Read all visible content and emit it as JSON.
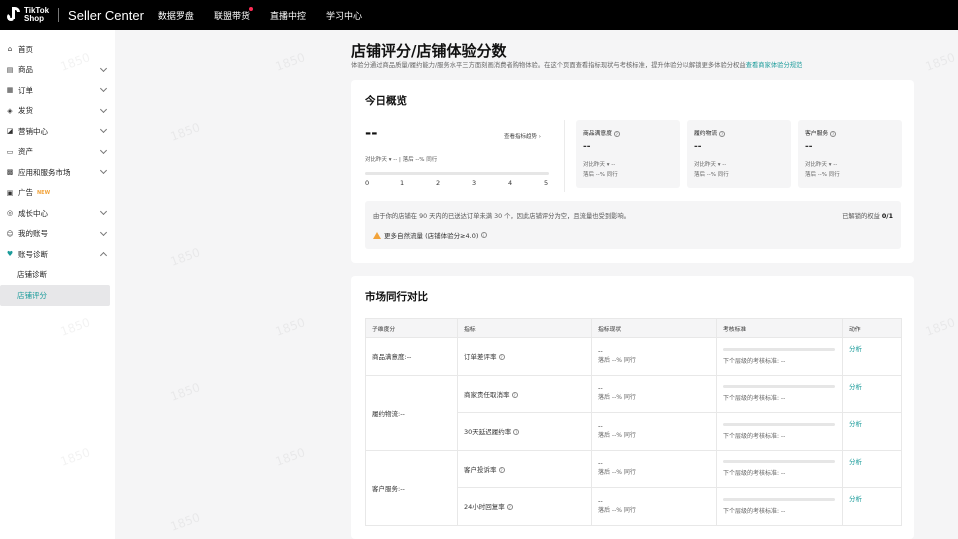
{
  "topbar": {
    "brand_line1": "TikTok",
    "brand_line2": "Shop",
    "title": "Seller Center",
    "nav": [
      "数据罗盘",
      "联盟带货",
      "直播中控",
      "学习中心"
    ]
  },
  "sidebar": {
    "items": [
      {
        "icon": "⌂",
        "label": "首页"
      },
      {
        "icon": "▤",
        "label": "商品"
      },
      {
        "icon": "▦",
        "label": "订单"
      },
      {
        "icon": "◈",
        "label": "发货"
      },
      {
        "icon": "◪",
        "label": "营销中心"
      },
      {
        "icon": "▭",
        "label": "资产"
      },
      {
        "icon": "▩",
        "label": "应用和服务市场"
      },
      {
        "icon": "▣",
        "label": "广告",
        "badge": "NEW"
      },
      {
        "icon": "◎",
        "label": "成长中心"
      },
      {
        "icon": "☺",
        "label": "我的账号"
      },
      {
        "icon": "♥",
        "label": "账号诊断"
      }
    ],
    "sub_items": [
      "店铺诊断",
      "店铺评分"
    ]
  },
  "watermark": "1850",
  "page": {
    "title": "店铺评分/店铺体验分数",
    "desc": "体验分通过商品质量/履约能力/服务水平三方面刻画消费者购物体验。在这个页面查看指标现状与考核标准，提升体验分以解锁更多体验分权益",
    "desc_link": "查看商家体验分规范"
  },
  "overview": {
    "title": "今日概览",
    "score": "--",
    "trend_link": "查看指标趋势 ›",
    "compare": "对比昨天 ▾ -- | 落后 --% 同行",
    "scale_labels": [
      "0",
      "1",
      "2",
      "3",
      "4",
      "5"
    ],
    "score_fraction": 0,
    "metrics": [
      {
        "title": "商品满意度",
        "value": "--",
        "line1": "对比昨天 ▾ --",
        "line2": "落后 --% 同行"
      },
      {
        "title": "履约物流",
        "value": "--",
        "line1": "对比昨天 ▾ --",
        "line2": "落后 --% 同行"
      },
      {
        "title": "客户服务",
        "value": "--",
        "line1": "对比昨天 ▾ --",
        "line2": "落后 --% 同行"
      }
    ],
    "notice_text": "由于你的店铺在 90 天内的已送达订单未满 30 个，因此店铺评分为空，且流量也受到影响。",
    "notice_right_label": "已解锁的权益",
    "notice_right_value": "0/1",
    "warning": "更多自然流量 (店铺体验分≥4.0)"
  },
  "comparison": {
    "title": "市场同行对比",
    "headers": [
      "子维度分",
      "指标",
      "指标现状",
      "考核标准",
      "动作"
    ],
    "groups": [
      {
        "dimension": "商品满意度:--",
        "rows": [
          {
            "metric": "订单差评率",
            "value": "--",
            "sub": "落后 --% 同行",
            "standard": "下个层级的考核标准: --",
            "action": "分析"
          }
        ]
      },
      {
        "dimension": "履约物流:--",
        "rows": [
          {
            "metric": "商家责任取消率",
            "value": "--",
            "sub": "落后 --% 同行",
            "standard": "下个层级的考核标准: --",
            "action": "分析"
          },
          {
            "metric": "30天延迟履约率",
            "value": "--",
            "sub": "落后 --% 同行",
            "standard": "下个层级的考核标准: --",
            "action": "分析"
          }
        ]
      },
      {
        "dimension": "客户服务:--",
        "rows": [
          {
            "metric": "客户投诉率",
            "value": "--",
            "sub": "落后 --% 同行",
            "standard": "下个层级的考核标准: --",
            "action": "分析"
          },
          {
            "metric": "24小时回复率",
            "value": "--",
            "sub": "落后 --% 同行",
            "standard": "下个层级的考核标准: --",
            "action": "分析"
          }
        ]
      }
    ]
  },
  "colors": {
    "accent": "#1a9b9a",
    "warning": "#f2a33a",
    "topbar": "#000000"
  }
}
